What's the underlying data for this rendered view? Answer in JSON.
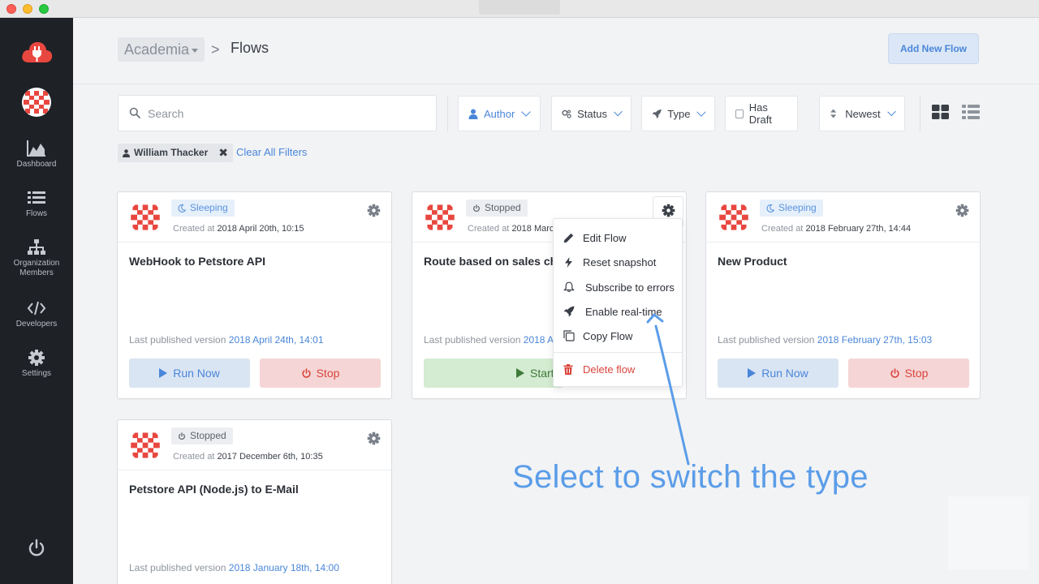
{
  "workspace": {
    "name": "Academia"
  },
  "breadcrumb": {
    "separator": ">",
    "page_title": "Flows"
  },
  "header": {
    "add_button": "Add New Flow"
  },
  "sidebar": {
    "items": [
      {
        "label": "Dashboard",
        "icon": "chart-area-icon"
      },
      {
        "label": "Flows",
        "icon": "list-icon"
      },
      {
        "label": "Organization Members",
        "icon": "org-chart-icon"
      },
      {
        "label": "Developers",
        "icon": "code-icon"
      },
      {
        "label": "Settings",
        "icon": "gear-icon"
      }
    ]
  },
  "toolbar": {
    "search_placeholder": "Search",
    "author_label": "Author",
    "status_label": "Status",
    "type_label": "Type",
    "has_draft_label": "Has Draft",
    "sort_label": "Newest"
  },
  "filters": {
    "chip_label": "William Thacker",
    "chip_remove": "✖",
    "clear_label": "Clear All Filters"
  },
  "cards": [
    {
      "status": "Sleeping",
      "created_prefix": "Created at",
      "created": "2018 April 20th, 10:15",
      "title": "WebHook to Petstore API",
      "published_prefix": "Last published version",
      "published": "2018 April 24th, 14:01",
      "run_label": "Run Now",
      "stop_label": "Stop"
    },
    {
      "status": "Stopped",
      "created_prefix": "Created at",
      "created": "2018 Marc",
      "title": "Route based on sales cha",
      "published_prefix": "Last published version",
      "published": "2018 A",
      "start_label": "Start"
    },
    {
      "status": "Sleeping",
      "created_prefix": "Created at",
      "created": "2018 February 27th, 14:44",
      "title": "New Product",
      "published_prefix": "Last published version",
      "published": "2018 February 27th, 15:03",
      "run_label": "Run Now",
      "stop_label": "Stop"
    },
    {
      "status": "Stopped",
      "created_prefix": "Created at",
      "created": "2017 December 6th, 10:35",
      "title": "Petstore API (Node.js) to E-Mail",
      "published_prefix": "Last published version",
      "published": "2018 January 18th, 14:00"
    }
  ],
  "menu": {
    "items": [
      {
        "label": "Edit Flow",
        "icon": "pencil-icon"
      },
      {
        "label": "Reset snapshot",
        "icon": "bolt-icon"
      },
      {
        "label": "Subscribe to errors",
        "icon": "bell-icon"
      },
      {
        "label": "Enable real-time",
        "icon": "rocket-icon"
      },
      {
        "label": "Copy Flow",
        "icon": "copy-icon"
      },
      {
        "label": "Delete flow",
        "icon": "trash-icon"
      }
    ]
  },
  "annotation": {
    "text": "Select to switch the type"
  },
  "colors": {
    "sidebar_bg": "#1e2126",
    "accent": "#4a86d9",
    "danger": "#d9453d",
    "success": "#3f7a3a",
    "brand": "#e8473f"
  }
}
